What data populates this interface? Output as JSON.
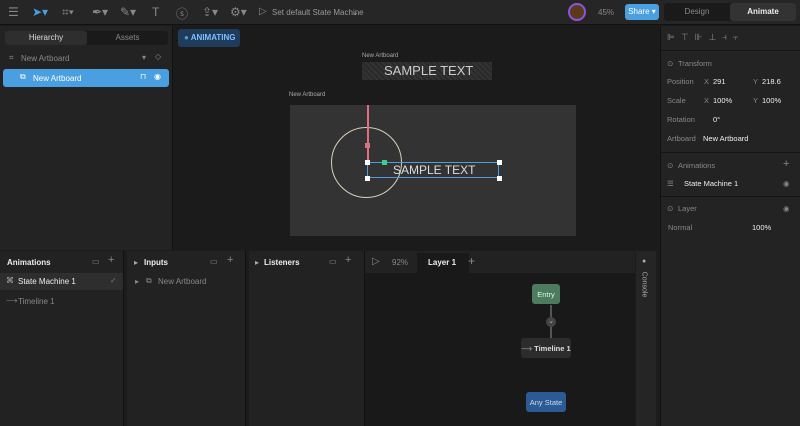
{
  "toolbar": {
    "state_machine_label": "Set default State Machine",
    "zoom": "45%",
    "share": "Share",
    "mode_design": "Design",
    "mode_animate": "Animate"
  },
  "left_panel": {
    "tab_hierarchy": "Hierarchy",
    "tab_assets": "Assets",
    "artboard_select": "New Artboard",
    "selected_item": "New Artboard"
  },
  "canvas": {
    "badge": "ANIMATING",
    "artboard_label_top": "New Artboard",
    "artboard_label": "New Artboard",
    "sample_text": "SAMPLE TEXT"
  },
  "right_panel": {
    "transform": {
      "title": "Transform",
      "position_label": "Position",
      "x_label": "X",
      "x": "291",
      "y_label": "Y",
      "y": "218.6",
      "scale_label": "Scale",
      "scale_x": "100%",
      "scale_y": "100%",
      "rotation_label": "Rotation",
      "rotation": "0°",
      "artboard_label": "Artboard",
      "artboard": "New Artboard"
    },
    "animations": {
      "title": "Animations",
      "item": "State Machine 1"
    },
    "layer": {
      "title": "Layer",
      "blend": "Normal",
      "opacity": "100%"
    }
  },
  "bottom": {
    "animations": {
      "title": "Animations",
      "items": [
        "State Machine 1",
        "Timeline 1"
      ]
    },
    "inputs": {
      "title": "Inputs",
      "item": "New Artboard"
    },
    "listeners": {
      "title": "Listeners"
    },
    "graph": {
      "zoom": "92%",
      "layer_tab": "Layer 1",
      "entry": "Entry",
      "timeline": "Timeline 1",
      "any_state": "Any State"
    },
    "console": "Console"
  },
  "colors": {
    "accent": "#4a9fe0",
    "entry": "#4e7a5e",
    "any_state": "#2c5a94"
  }
}
